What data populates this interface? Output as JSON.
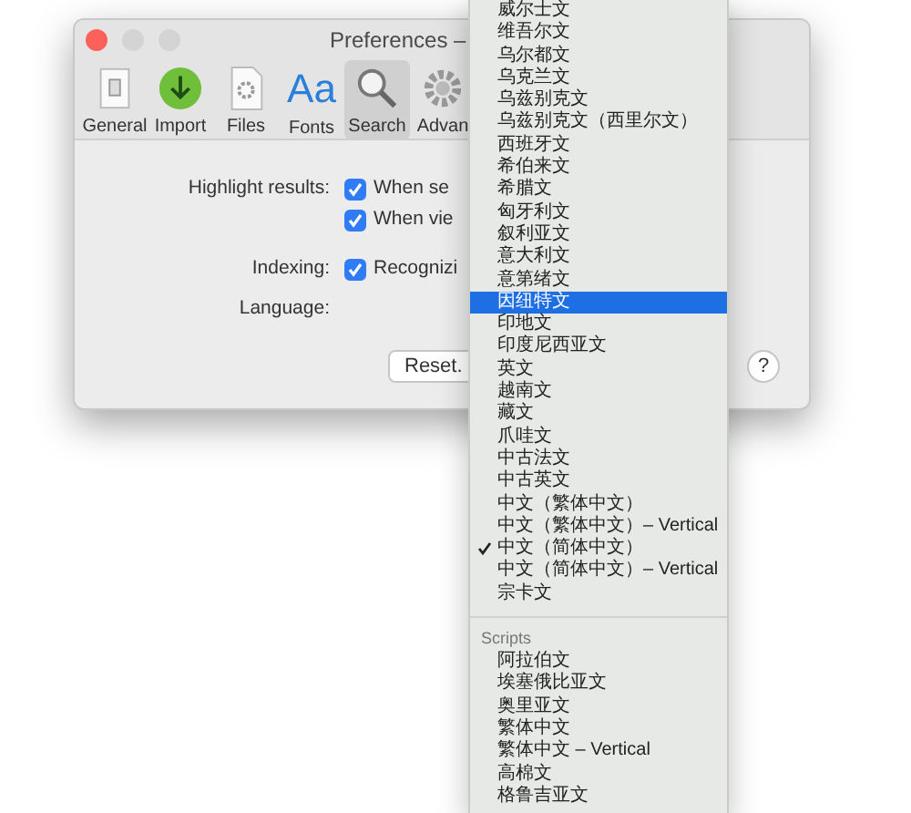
{
  "window": {
    "title": "Preferences –"
  },
  "toolbar": [
    {
      "label": "General",
      "kind": "general",
      "selected": false
    },
    {
      "label": "Import",
      "kind": "import",
      "selected": false
    },
    {
      "label": "Files",
      "kind": "files",
      "selected": false
    },
    {
      "label": "Fonts",
      "kind": "fonts",
      "glyph": "Aa",
      "selected": false
    },
    {
      "label": "Search",
      "kind": "search",
      "selected": true
    },
    {
      "label": "Advan",
      "kind": "advanced",
      "selected": false
    }
  ],
  "settings": [
    {
      "label": "Highlight results:",
      "option": "When se",
      "checked": true
    },
    {
      "option": "When vie",
      "checked": true
    },
    {
      "label": "Indexing:",
      "option": "Recognizi",
      "checked": true
    },
    {
      "label": "Language:"
    }
  ],
  "buttons": [
    {
      "label": "Reset.",
      "kind": "text"
    },
    {
      "label": "?",
      "kind": "help"
    }
  ],
  "menu": {
    "groups": [
      {
        "items": [
          {
            "label": "威尔士文",
            "selected": false,
            "checked": false
          },
          {
            "label": "维吾尔文",
            "selected": false,
            "checked": false
          },
          {
            "label": "乌尔都文",
            "selected": false,
            "checked": false
          },
          {
            "label": "乌克兰文",
            "selected": false,
            "checked": false
          },
          {
            "label": "乌兹别克文",
            "selected": false,
            "checked": false
          },
          {
            "label": "乌兹别克文（西里尔文）",
            "selected": false,
            "checked": false
          },
          {
            "label": "西班牙文",
            "selected": false,
            "checked": false
          },
          {
            "label": "希伯来文",
            "selected": false,
            "checked": false
          },
          {
            "label": "希腊文",
            "selected": false,
            "checked": false
          },
          {
            "label": "匈牙利文",
            "selected": false,
            "checked": false
          },
          {
            "label": "叙利亚文",
            "selected": false,
            "checked": false
          },
          {
            "label": "意大利文",
            "selected": false,
            "checked": false
          },
          {
            "label": "意第绪文",
            "selected": false,
            "checked": false
          },
          {
            "label": "因纽特文",
            "selected": true,
            "checked": false
          },
          {
            "label": "印地文",
            "selected": false,
            "checked": false
          },
          {
            "label": "印度尼西亚文",
            "selected": false,
            "checked": false
          },
          {
            "label": "英文",
            "selected": false,
            "checked": false
          },
          {
            "label": "越南文",
            "selected": false,
            "checked": false
          },
          {
            "label": "藏文",
            "selected": false,
            "checked": false
          },
          {
            "label": "爪哇文",
            "selected": false,
            "checked": false
          },
          {
            "label": "中古法文",
            "selected": false,
            "checked": false
          },
          {
            "label": "中古英文",
            "selected": false,
            "checked": false
          },
          {
            "label": "中文（繁体中文）",
            "selected": false,
            "checked": false
          },
          {
            "label": "中文（繁体中文）– Vertical",
            "selected": false,
            "checked": false
          },
          {
            "label": "中文（简体中文）",
            "selected": false,
            "checked": true
          },
          {
            "label": "中文（简体中文）– Vertical",
            "selected": false,
            "checked": false
          },
          {
            "label": "宗卡文",
            "selected": false,
            "checked": false
          }
        ]
      },
      {
        "header": "Scripts",
        "items": [
          {
            "label": "阿拉伯文",
            "selected": false,
            "checked": false
          },
          {
            "label": "埃塞俄比亚文",
            "selected": false,
            "checked": false
          },
          {
            "label": "奥里亚文",
            "selected": false,
            "checked": false
          },
          {
            "label": "繁体中文",
            "selected": false,
            "checked": false
          },
          {
            "label": "繁体中文 – Vertical",
            "selected": false,
            "checked": false
          },
          {
            "label": "高棉文",
            "selected": false,
            "checked": false
          },
          {
            "label": "格鲁吉亚文",
            "selected": false,
            "checked": false
          }
        ]
      }
    ]
  }
}
